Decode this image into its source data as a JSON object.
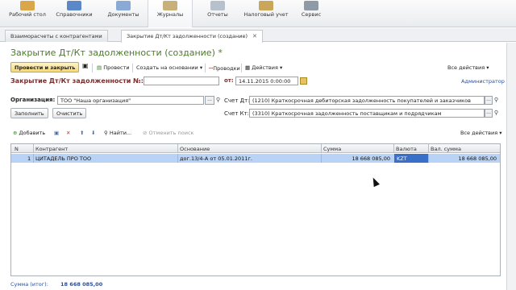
{
  "sections": [
    {
      "label": "Рабочий стол",
      "icon": "desktop-icon",
      "color": "#d9a64a"
    },
    {
      "label": "Справочники",
      "icon": "books-icon",
      "color": "#5c88c9"
    },
    {
      "label": "Документы",
      "icon": "documents-icon",
      "color": "#8aa9d6"
    },
    {
      "label": "Журналы",
      "icon": "journals-icon",
      "color": "#c8b07a"
    },
    {
      "label": "Отчеты",
      "icon": "reports-icon",
      "color": "#b7c1cc"
    },
    {
      "label": "Налоговый учет",
      "icon": "tax-icon",
      "color": "#c9a65a"
    },
    {
      "label": "Сервис",
      "icon": "service-icon",
      "color": "#8f9aa6"
    }
  ],
  "tabs": [
    {
      "label": "Взаиморасчеты с контрагентами"
    },
    {
      "label": "Закрытие Дт/Кт задолженности (создание)"
    }
  ],
  "form": {
    "title": "Закрытие Дт/Кт задолженности (создание) *",
    "post_close": "Провести и закрыть",
    "post": "Провести",
    "create_based": "Создать на основании",
    "entries": "Проводки",
    "actions": "Действия",
    "all_actions": "Все действия",
    "doc_label": "Закрытие Дт/Кт задолженности №:",
    "doc_number": "",
    "from_label": "от:",
    "date": "14.11.2015 0:00:00",
    "user": "Администратор",
    "org_label": "Организация:",
    "org_value": "ТОО \"Наша организация\"",
    "dt_label": "Счет Дт:",
    "dt_value": "(1210) Краткосрочная дебиторская задолженность покупателей и заказчиков",
    "kt_label": "Счет Кт:",
    "kt_value": "(3310) Краткосрочная задолженность поставщикам и подрядчикам",
    "fill": "Заполнить",
    "clear": "Очистить",
    "add": "Добавить",
    "find": "Найти...",
    "cancel_search": "Отменить поиск",
    "grid_all_actions": "Все действия"
  },
  "grid": {
    "headers": [
      "N",
      "Контрагент",
      "Основание",
      "Сумма",
      "Валюта",
      "Вал. сумма"
    ],
    "rows": [
      {
        "n": "1",
        "counterparty": "ЦИТАДЕЛЬ ПРО ТОО",
        "basis": "дог.13/4-А от 05.01.2011г.",
        "sum": "18 668 085,00",
        "currency": "KZT",
        "cur_sum": "18 668 085,00"
      }
    ]
  },
  "footer": {
    "total_label": "Сумма (итог):",
    "total_value": "18 668 085,00"
  }
}
